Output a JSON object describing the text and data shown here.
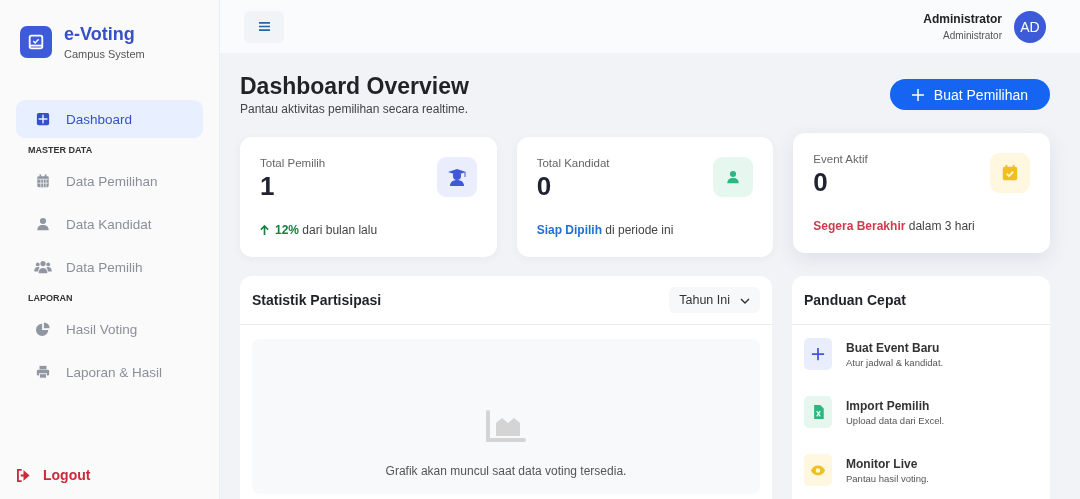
{
  "brand": {
    "title": "e-Voting",
    "subtitle": "Campus System"
  },
  "nav": [
    {
      "kind": "item",
      "label": "Dashboard",
      "selected": true
    },
    {
      "kind": "heading",
      "label": "MASTER DATA"
    },
    {
      "kind": "item",
      "label": "Data Pemilihan",
      "selected": false
    },
    {
      "kind": "item",
      "label": "Data Kandidat",
      "selected": false
    },
    {
      "kind": "item",
      "label": "Data Pemilih",
      "selected": false
    },
    {
      "kind": "heading",
      "label": "LAPORAN"
    },
    {
      "kind": "item",
      "label": "Hasil Voting",
      "selected": false
    },
    {
      "kind": "item",
      "label": "Laporan & Hasil",
      "selected": false
    }
  ],
  "logout": {
    "label": "Logout"
  },
  "user": {
    "name": "Administrator",
    "role": "Administrator",
    "initials": "AD"
  },
  "page": {
    "title": "Dashboard Overview",
    "subtitle": "Pantau aktivitas pemilihan secara realtime.",
    "action": "Buat Pemilihan"
  },
  "stats": [
    {
      "label": "Total Pemilih",
      "value": "1",
      "color": "#15803d",
      "footer": "**12%** dari bulan lalu"
    },
    {
      "label": "Total Kandidat",
      "value": "0",
      "color": "#1e6fd9",
      "footer": "**Siap Dipilih** di periode ini"
    },
    {
      "label": "Event Aktif",
      "value": "0",
      "color": "#d03a4a",
      "footer": "**Segera Berakhir** dalam 3 hari"
    }
  ],
  "chart_panel": {
    "title": "Statistik Partisipasi",
    "filter": "Tahun Ini",
    "empty_text": "Grafik akan muncul saat data voting tersedia."
  },
  "guide": {
    "title": "Panduan Cepat",
    "items": [
      {
        "title": "Buat Event Baru",
        "text": "Atur jadwal & kandidat."
      },
      {
        "title": "Import Pemilih",
        "text": "Upload data dari Excel."
      },
      {
        "title": "Monitor Live",
        "text": "Pantau hasil voting."
      }
    ]
  }
}
